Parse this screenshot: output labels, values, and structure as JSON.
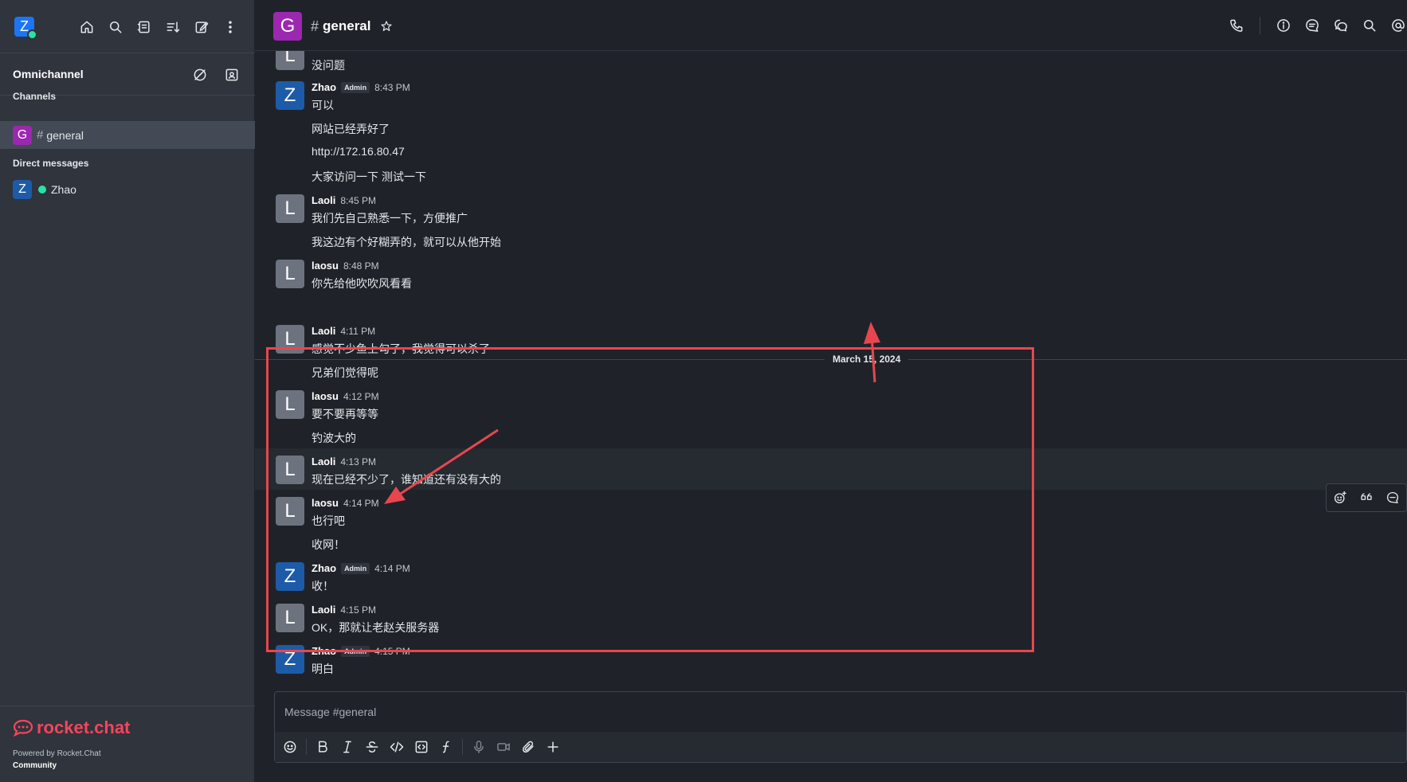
{
  "user": {
    "avatar_letter": "Z",
    "status": "online"
  },
  "sidebar": {
    "omnichannel_title": "Omnichannel",
    "channels_label": "Channels",
    "channels": [
      {
        "letter": "G",
        "name": "general",
        "color": "#9c27b0"
      }
    ],
    "dm_label": "Direct messages",
    "dms": [
      {
        "letter": "Z",
        "name": "Zhao",
        "color": "#1d5ba8"
      }
    ],
    "brand": "rocket.chat",
    "powered_by": "Powered by Rocket.Chat",
    "edition": "Community"
  },
  "header": {
    "avatar_letter": "G",
    "room_name": "general"
  },
  "messages": [
    {
      "letter": "L",
      "lines": [
        "没问题"
      ]
    },
    {
      "letter": "Z",
      "name": "Zhao",
      "badge": "Admin",
      "time": "8:43 PM",
      "lines": [
        "可以",
        "网站已经弄好了",
        "http://172.16.80.47",
        "大家访问一下 测试一下"
      ]
    },
    {
      "letter": "L",
      "name": "Laoli",
      "time": "8:45 PM",
      "lines": [
        "我们先自己熟悉一下，方便推广",
        "我这边有个好糊弄的，就可以从他开始"
      ]
    },
    {
      "letter": "L",
      "name": "laosu",
      "time": "8:48 PM",
      "lines": [
        "你先给他吹吹风看看"
      ]
    },
    {
      "letter": "L",
      "name": "Laoli",
      "time": "4:11 PM",
      "lines": [
        "感觉不少鱼上勾了，我觉得可以杀了",
        "兄弟们觉得呢"
      ]
    },
    {
      "letter": "L",
      "name": "laosu",
      "time": "4:12 PM",
      "lines": [
        "要不要再等等",
        "钓波大的"
      ]
    },
    {
      "letter": "L",
      "name": "Laoli",
      "time": "4:13 PM",
      "lines": [
        "现在已经不少了，谁知道还有没有大的"
      ]
    },
    {
      "letter": "L",
      "name": "laosu",
      "time": "4:14 PM",
      "lines": [
        "也行吧",
        "收网！"
      ]
    },
    {
      "letter": "Z",
      "name": "Zhao",
      "badge": "Admin",
      "time": "4:14 PM",
      "lines": [
        "收！"
      ]
    },
    {
      "letter": "L",
      "name": "Laoli",
      "time": "4:15 PM",
      "lines": [
        "OK，那就让老赵关服务器"
      ]
    },
    {
      "letter": "Z",
      "name": "Zhao",
      "badge": "Admin",
      "time": "4:15 PM",
      "lines": [
        "明白"
      ]
    }
  ],
  "date_divider": "March 15, 2024",
  "composer": {
    "placeholder": "Message #general"
  },
  "colors": {
    "annotation": "#e8464f",
    "sidebar_bg": "#2f343d",
    "main_bg": "#1f2329",
    "brand": "#f5455c"
  }
}
